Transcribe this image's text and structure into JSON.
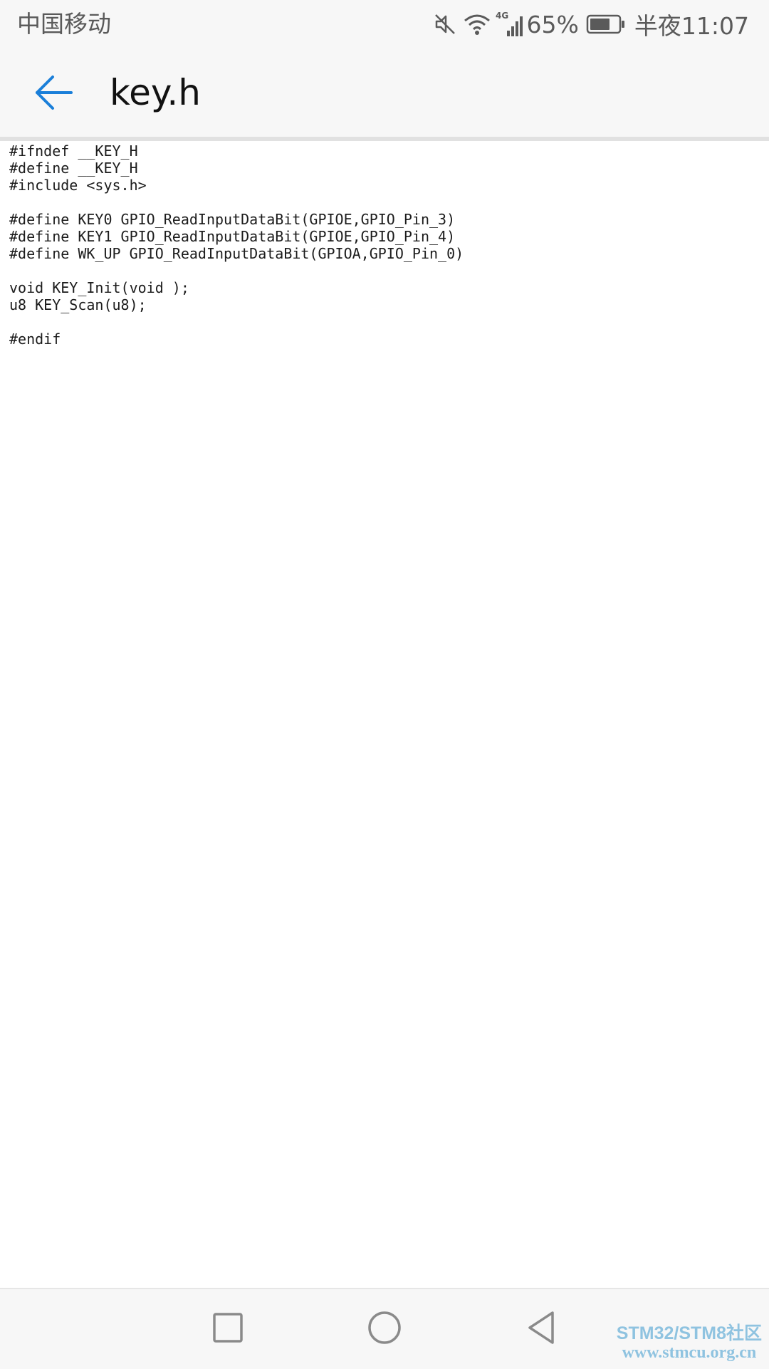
{
  "status_bar": {
    "carrier": "中国移动",
    "network_type": "4G",
    "battery_percent": "65%",
    "time": "半夜11:07",
    "icons": [
      "mute-icon",
      "wifi-icon",
      "signal-icon",
      "battery-icon"
    ]
  },
  "app_bar": {
    "title": "key.h",
    "back_icon": "arrow-left-icon",
    "accent_color": "#1a7fd9"
  },
  "editor": {
    "lines": [
      "#ifndef __KEY_H",
      "#define __KEY_H",
      "#include <sys.h>",
      "",
      "#define KEY0 GPIO_ReadInputDataBit(GPIOE,GPIO_Pin_3)",
      "#define KEY1 GPIO_ReadInputDataBit(GPIOE,GPIO_Pin_4)",
      "#define WK_UP GPIO_ReadInputDataBit(GPIOA,GPIO_Pin_0)",
      "",
      "void KEY_Init(void );",
      "u8 KEY_Scan(u8);",
      "",
      "#endif"
    ]
  },
  "nav_bar": {
    "buttons": [
      "recents-icon",
      "home-icon",
      "back-icon"
    ]
  },
  "watermark": {
    "line1": "STM32/STM8社区",
    "line2": "www.stmcu.org.cn"
  }
}
